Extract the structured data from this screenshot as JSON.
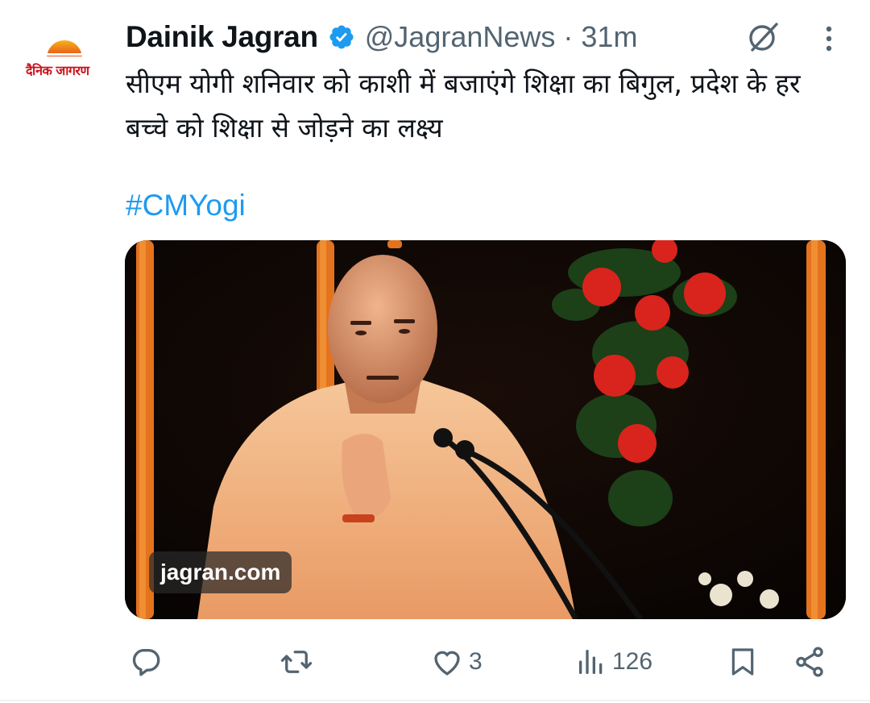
{
  "account": {
    "logo_text": "दैनिक जागरण",
    "name": "Dainik Jagran",
    "handle": "@JagranNews",
    "separator": "·",
    "time": "31m"
  },
  "tweet": {
    "text": "सीएम योगी शनिवार को काशी में बजाएंगे शिक्षा का बिगुल, प्रदेश के हर बच्चे को शिक्षा से जोड़ने का लक्ष्य",
    "hashtag": "#CMYogi"
  },
  "media": {
    "watermark": "jagran.com"
  },
  "actions": {
    "reply_icon": "reply-icon",
    "retweet_icon": "retweet-icon",
    "like_icon": "heart-icon",
    "like_count": "3",
    "views_icon": "views-bar-icon",
    "views_count": "126",
    "bookmark_icon": "bookmark-icon",
    "share_icon": "share-icon"
  },
  "colors": {
    "link": "#1d9bf0",
    "verified": "#1d9bf0",
    "secondary_text": "#536471",
    "logo_red": "#c8131c"
  }
}
